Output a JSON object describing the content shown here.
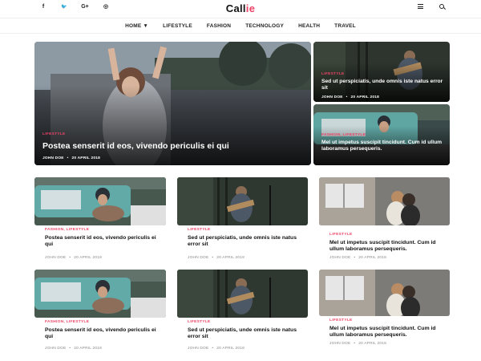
{
  "brand": {
    "logo_prefix": "Call",
    "logo_accent": "ie",
    "accent_color": "#ee4266"
  },
  "header": {
    "social": [
      {
        "icon": "facebook-icon",
        "glyph": "f"
      },
      {
        "icon": "twitter-icon",
        "glyph": "🐦"
      },
      {
        "icon": "google-plus-icon",
        "glyph": "G+"
      },
      {
        "icon": "instagram-icon",
        "glyph": "◎"
      }
    ]
  },
  "nav": {
    "items": [
      "HOME",
      "LIFESTYLE",
      "FASHION",
      "TECHNOLOGY",
      "HEALTH",
      "TRAVEL"
    ]
  },
  "featured": {
    "main": {
      "category": "LIFESTYLE",
      "title": "Postea senserit id eos, vivendo periculis ei qui",
      "author": "JOHN DOE",
      "date": "20 APRIL 2018"
    },
    "side1": {
      "category": "LIFESTYLE",
      "title": "Sed ut perspiciatis, unde omnis iste natus error sit",
      "author": "JOHN DOE",
      "date": "20 APRIL 2018"
    },
    "side2": {
      "category": "FASHION, LIFESTYLE",
      "title": "Mel ut impetus suscipit tincidunt. Cum id ullum laboramus persequeris.",
      "author": "JOHN DOE",
      "date": "20 APRIL 2018"
    }
  },
  "grid": [
    {
      "category": "FASHION, LIFESTYLE",
      "title": "Postea senserit id eos, vivendo periculis ei qui",
      "author": "JOHN DOE",
      "date": "20 APRIL 2018"
    },
    {
      "category": "LIFESTYLE",
      "title": "Sed ut perspiciatis, unde omnis iste natus error sit",
      "author": "JOHN DOE",
      "date": "20 APRIL 2018"
    },
    {
      "category": "LIFESTYLE",
      "title": "Mel ut impetus suscipit tincidunt. Cum id ullum laboramus persequeris.",
      "author": "JOHN DOE",
      "date": "20 APRIL 2018"
    },
    {
      "category": "FASHION, LIFESTYLE",
      "title": "Postea senserit id eos, vivendo periculis ei qui",
      "author": "JOHN DOE",
      "date": "20 APRIL 2018"
    },
    {
      "category": "LIFESTYLE",
      "title": "Sed ut perspiciatis, unde omnis iste natus error sit",
      "author": "JOHN DOE",
      "date": "20 APRIL 2018"
    },
    {
      "category": "LIFESTYLE",
      "title": "Mel ut impetus suscipit tincidunt. Cum id ullum laboramus persequeris.",
      "author": "JOHN DOE",
      "date": "20 APRIL 2018"
    }
  ]
}
